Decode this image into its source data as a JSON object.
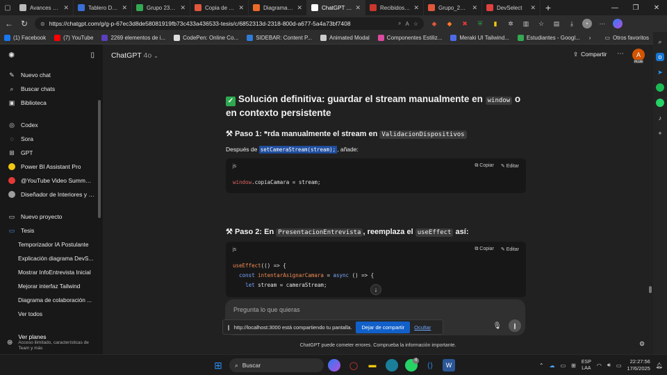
{
  "browser": {
    "tabs": [
      {
        "title": "Avances de en",
        "color": "#bbbbbb"
      },
      {
        "title": "Tablero DSA -",
        "color": "#3a6fd8"
      },
      {
        "title": "Grupo 23_Cap",
        "color": "#34a853"
      },
      {
        "title": "Copia de TESIS",
        "color": "#e0573b"
      },
      {
        "title": "Diagrama en b",
        "color": "#ea6a2a"
      },
      {
        "title": "ChatGPT - Tesi",
        "color": "#ffffff",
        "active": true
      },
      {
        "title": "Recibidos (4.5C",
        "color": "#c9372c"
      },
      {
        "title": "Grupo_23_Cap",
        "color": "#e0573b"
      },
      {
        "title": "DevSelect",
        "color": "#e04040"
      }
    ],
    "url": "https://chatgpt.com/g/g-p-67ec3d8de58081919fb73c433a436533-tesis/c/6852313d-2318-800d-a677-5a4a73bf7408",
    "bookmarks": [
      {
        "label": "(1) Facebook",
        "color": "#1877f2"
      },
      {
        "label": "(7) YouTube",
        "color": "#ff0000"
      },
      {
        "label": "2269 elementos de i...",
        "color": "#5b3fbf"
      },
      {
        "label": "CodePen: Online Co...",
        "color": "#dddddd"
      },
      {
        "label": "SIDEBAR: Content P...",
        "color": "#2f7bd8"
      },
      {
        "label": "Animated Modal",
        "color": "#cccccc"
      },
      {
        "label": "Componentes Estiliz...",
        "color": "#db4aa0"
      },
      {
        "label": "Meraki UI Tailwind...",
        "color": "#4d6be8"
      },
      {
        "label": "Estudiantes - Googl...",
        "color": "#34a853"
      }
    ],
    "bookmarks_other": "Otros favoritos"
  },
  "app": {
    "model_name": "ChatGPT",
    "model_version": "4o",
    "share_label": "Compartir",
    "avatar_letter": "A",
    "avatar_badge": "PLUS"
  },
  "sidebar": {
    "nav": [
      {
        "label": "Nuevo chat",
        "icon": "edit-icon",
        "glyph": "✎"
      },
      {
        "label": "Buscar chats",
        "icon": "search-icon",
        "glyph": "⌕"
      },
      {
        "label": "Biblioteca",
        "icon": "library-icon",
        "glyph": "▣"
      }
    ],
    "tools": [
      {
        "label": "Codex",
        "icon": "codex-icon",
        "glyph": "◎"
      },
      {
        "label": "Sora",
        "icon": "sora-icon",
        "glyph": "◌"
      },
      {
        "label": "GPT",
        "icon": "gpt-grid-icon",
        "glyph": "⊞"
      }
    ],
    "gpts": [
      {
        "label": "Power BI Assistant Pro",
        "color": "#f2c811"
      },
      {
        "label": "@YouTube Video Summari...",
        "color": "#e53935"
      },
      {
        "label": "Diseñador de Interiores y P...",
        "color": "#9e9e9e"
      }
    ],
    "new_project": "Nuevo proyecto",
    "project_name": "Tesis",
    "chats": [
      "Temporizador IA Postulante",
      "Explicación diagrama DevS...",
      "Mostrar InfoEntrevista Inicial",
      "Mejorar interfaz Tailwind",
      "Diagrama de colaboración ...",
      "Ver todos"
    ],
    "plans_title": "Ver planes",
    "plans_sub1": "Acceso ilimitado, características de",
    "plans_sub2": "Team y más"
  },
  "chat": {
    "heading_main": "Solución definitiva: guardar el stream manualmente en",
    "heading_code": "window",
    "heading_end": " o en contexto persistente",
    "step1_prefix": "Paso 1:",
    "step1_text": "rda manualmente el stream en",
    "step1_code": "ValidacionDispositivos",
    "para1_prefix": "Después de",
    "para1_code": "setCameraStream(stream);",
    "para1_suffix": ", añade:",
    "code1": {
      "lang": "js",
      "copy": "Copiar",
      "edit": "Editar",
      "lines": [
        "window",
        ".copiaCamara = stream;"
      ]
    },
    "step2_prefix": "Paso 2: En",
    "step2_code1": "PresentacionEntrevista",
    "step2_mid": ", reemplaza el",
    "step2_code2": "useEffect",
    "step2_end": " así:",
    "code2": {
      "lang": "js",
      "copy": "Copiar",
      "edit": "Editar",
      "l1_fn": "useEffect",
      "l1_rest": "(() => {",
      "l2_kw": "const",
      "l2_fn": "intentarAsignarCamara",
      "l2_mid": " = ",
      "l2_kw2": "async",
      "l2_rest": " () => {",
      "l3_kw": "let",
      "l3_rest": " stream = cameraStream;"
    },
    "composer_placeholder": "Pregunta lo que quieras",
    "share_notice": "http://localhost:3000 está compartiendo tu pantalla.",
    "share_stop": "Dejar de compartir",
    "share_hide": "Ocultar",
    "disclaimer": "ChatGPT puede cometer errores. Comprueba la información importante."
  },
  "taskbar": {
    "search": "Buscar",
    "lang1": "ESP",
    "lang2": "LAA",
    "time": "22:27:56",
    "date": "17/6/2025",
    "badge": "4"
  }
}
